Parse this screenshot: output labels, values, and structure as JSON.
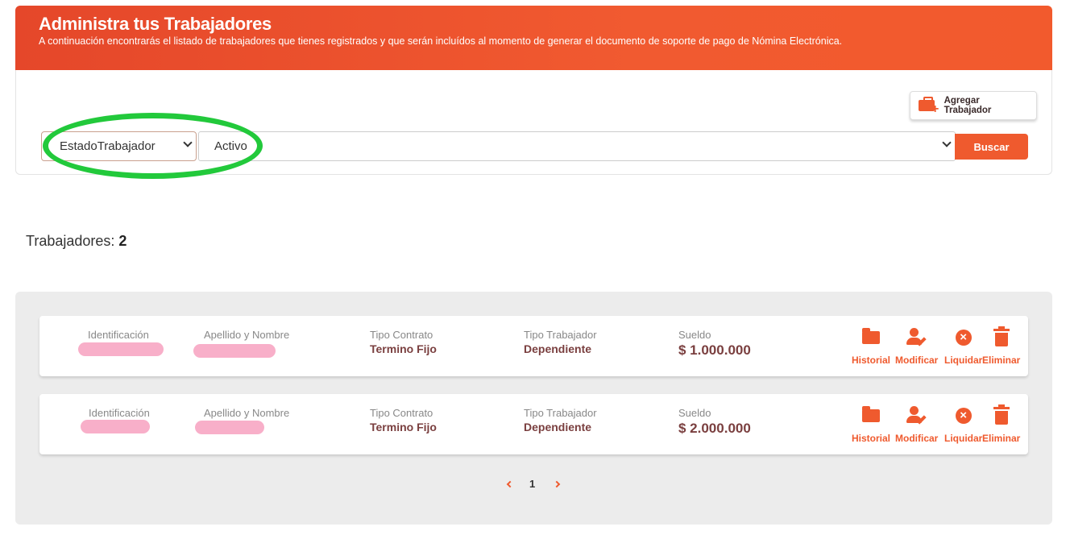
{
  "header": {
    "title": "Administra tus Trabajadores",
    "subtitle": "A continuación encontrarás el listado de trabajadores que tienes registrados y que serán incluídos al momento de generar el documento de soporte de pago de Nómina Electrónica."
  },
  "filters": {
    "add_label": "Agregar Trabajador",
    "field_select": "EstadoTrabajador",
    "value_select": "Activo",
    "search_label": "Buscar"
  },
  "summary": {
    "label": "Trabajadores:",
    "count": "2"
  },
  "labels": {
    "id": "Identificación",
    "name": "Apellido y Nombre",
    "contract": "Tipo Contrato",
    "worker_type": "Tipo Trabajador",
    "salary": "Sueldo"
  },
  "actions": {
    "history": "Historial",
    "edit": "Modificar",
    "settle": "Liquidar",
    "delete": "Eliminar"
  },
  "workers": [
    {
      "contract": "Termino Fijo",
      "worker_type": "Dependiente",
      "salary": "$ 1.000.000"
    },
    {
      "contract": "Termino Fijo",
      "worker_type": "Dependiente",
      "salary": "$ 2.000.000"
    }
  ],
  "pagination": {
    "current": "1"
  },
  "colors": {
    "accent": "#ef5a2e",
    "highlight": "#22c93b",
    "redaction": "#f8afc9"
  }
}
